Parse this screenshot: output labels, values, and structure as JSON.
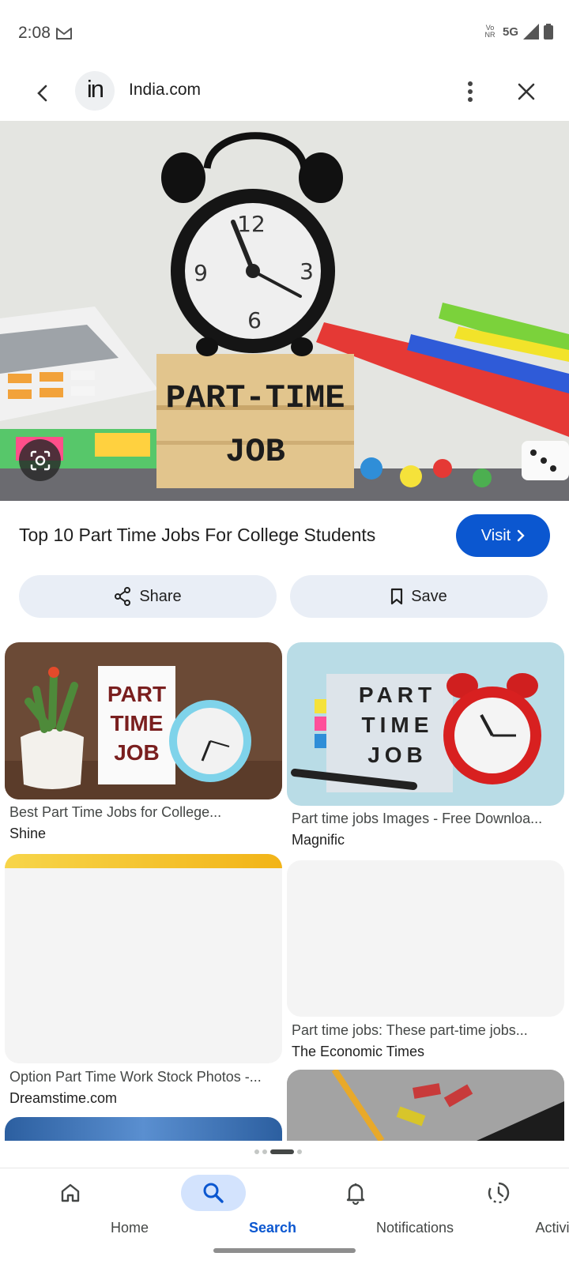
{
  "status_bar": {
    "time": "2:08",
    "network": "5G",
    "volte_label": "Vo NR"
  },
  "app_bar": {
    "site_logo_text": "in",
    "site_name": "India.com"
  },
  "hero": {
    "block_line1": "PART-TIME",
    "block_line2": "JOB"
  },
  "result": {
    "title": "Top 10 Part Time Jobs For College Students",
    "visit_label": "Visit",
    "share_label": "Share",
    "save_label": "Save"
  },
  "related": [
    {
      "caption": "Best Part Time Jobs for College...",
      "source": "Shine",
      "image_text": [
        "PART",
        "TIME",
        "JOB"
      ]
    },
    {
      "caption": "Part time jobs Images - Free Downloa...",
      "source": "Magnific",
      "image_text": [
        "PART",
        "TIME",
        "JOB"
      ]
    },
    {
      "caption": "Option Part Time Work Stock Photos -...",
      "source": "Dreamstime.com"
    },
    {
      "caption": "Part time jobs: These part-time jobs...",
      "source": "The Economic Times"
    }
  ],
  "bottom_nav": [
    {
      "label": "Home",
      "icon": "home-icon"
    },
    {
      "label": "Search",
      "icon": "search-icon",
      "active": true
    },
    {
      "label": "Notifications",
      "icon": "bell-icon"
    },
    {
      "label": "Activity",
      "icon": "activity-icon"
    }
  ],
  "colors": {
    "accent": "#0b57d0",
    "chip_bg": "#e9eef6",
    "nav_active_bg": "#d3e3fd"
  }
}
